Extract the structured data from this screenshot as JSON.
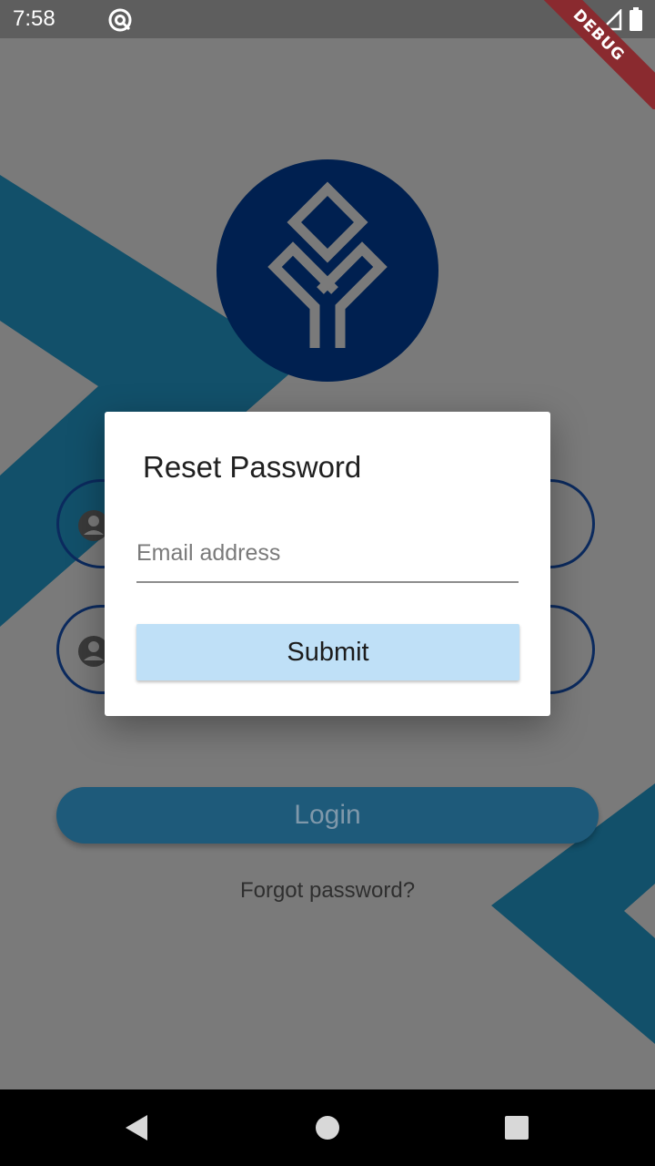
{
  "status_bar": {
    "time": "7:58",
    "icons": [
      "at-sign-icon",
      "signal-icon",
      "battery-icon"
    ]
  },
  "debug_banner": {
    "label": "DEBUG"
  },
  "login_form": {
    "username_icon": "account-circle-icon",
    "password_icon": "account-circle-icon",
    "login_label": "Login",
    "forgot_label": "Forgot password?"
  },
  "dialog": {
    "title": "Reset Password",
    "email_placeholder": "Email address",
    "email_value": "",
    "submit_label": "Submit"
  },
  "nav_bar": {
    "back": "back-icon",
    "home": "home-icon",
    "recents": "recents-icon"
  },
  "colors": {
    "brand_navy": "#002050",
    "teal_chevron": "#12506a",
    "login_button": "#1e5a7a",
    "submit_button": "#bfe0f7",
    "scrim": "#7a7a7a"
  }
}
